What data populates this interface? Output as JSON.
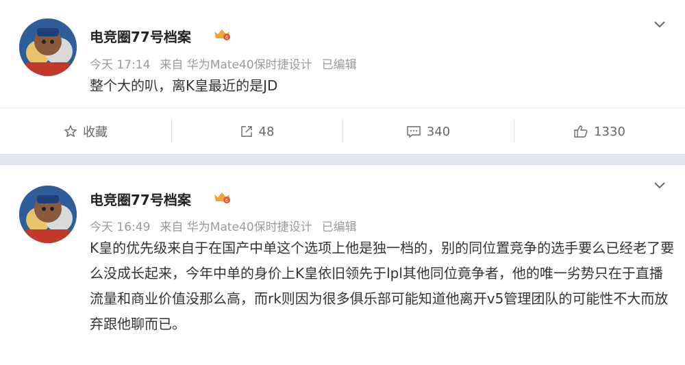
{
  "posts": [
    {
      "username": "电竞圈77号档案",
      "time": "今天 17:14",
      "source": "来自 华为Mate40保时捷设计",
      "edited": "已编辑",
      "content": "整个大的叭，离K皇最近的是JD",
      "actions": {
        "favorite": "收藏",
        "repost": "48",
        "comment": "340",
        "like": "1330"
      }
    },
    {
      "username": "电竞圈77号档案",
      "time": "今天 16:49",
      "source": "来自 华为Mate40保时捷设计",
      "edited": "已编辑",
      "content": "K皇的优先级来自于在国产中单这个选项上他是独一档的，别的同位置竞争的选手要么已经老了要么没成长起来，今年中单的身价上K皇依旧领先于lpl其他同位竟争者，他的唯一劣势只在于直播流量和商业价值没那么高，而rk则因为很多俱乐部可能知道他离开v5管理团队的可能性不大而放弃跟他聊而已。"
    }
  ],
  "colors": {
    "separator": "#dfe8f0",
    "meta_text": "#999999",
    "vip_badge": "#f0a63a"
  }
}
